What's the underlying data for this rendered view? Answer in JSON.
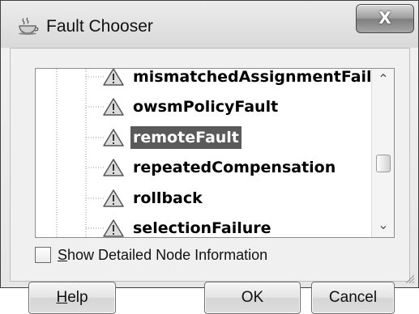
{
  "window": {
    "title": "Fault Chooser",
    "title_icon": "cup-icon",
    "close_glyph": "X"
  },
  "tree": {
    "items": [
      {
        "label": "mismatchedAssignmentFailure",
        "icon": "warning-icon",
        "selected": false
      },
      {
        "label": "owsmPolicyFault",
        "icon": "warning-icon",
        "selected": false
      },
      {
        "label": "remoteFault",
        "icon": "warning-icon",
        "selected": true
      },
      {
        "label": "repeatedCompensation",
        "icon": "warning-icon",
        "selected": false
      },
      {
        "label": "rollback",
        "icon": "warning-icon",
        "selected": false
      },
      {
        "label": "selectionFailure",
        "icon": "warning-icon",
        "selected": false
      }
    ],
    "scroll_up_glyph": "⌃",
    "scroll_down_glyph": "⌄"
  },
  "options": {
    "show_detailed": {
      "mnemonic": "S",
      "rest": "how Detailed Node Information",
      "checked": false
    }
  },
  "buttons": {
    "help": {
      "mnemonic": "H",
      "rest": "elp"
    },
    "ok": {
      "label": "OK"
    },
    "cancel": {
      "label": "Cancel"
    }
  },
  "colors": {
    "selection": "#5a5a5a",
    "warning_fill": "#dcdcdc",
    "warning_stroke": "#555555"
  }
}
